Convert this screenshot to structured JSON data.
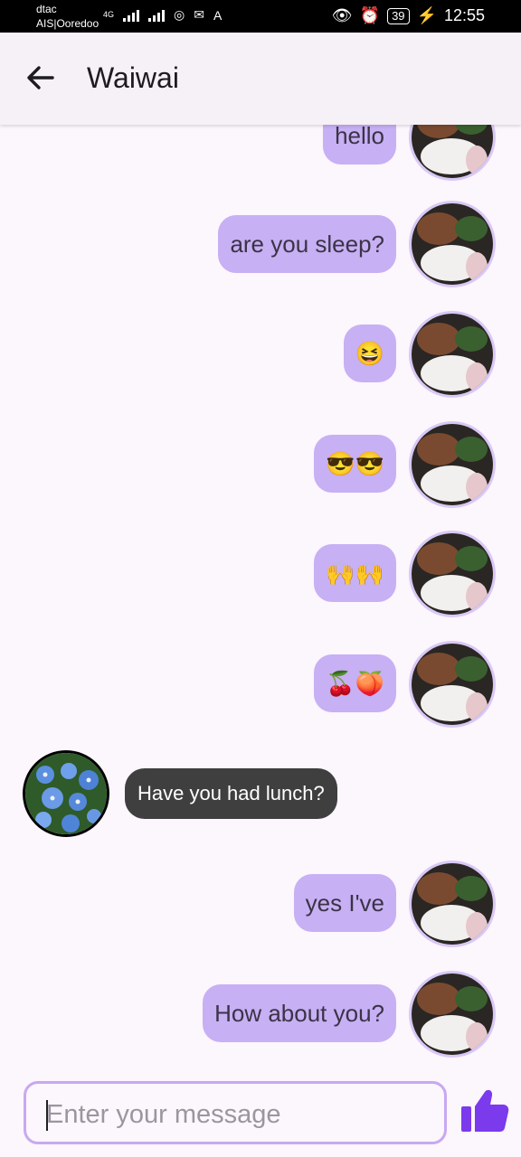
{
  "status_bar": {
    "carrier_1": "dtac",
    "carrier_2": "AIS|Ooredoo",
    "network": "4G",
    "battery": "39",
    "time": "12:55"
  },
  "header": {
    "title": "Waiwai"
  },
  "messages": [
    {
      "sender": "me",
      "text": "hello"
    },
    {
      "sender": "me",
      "text": "are you sleep?"
    },
    {
      "sender": "me",
      "text": "😆"
    },
    {
      "sender": "me",
      "text": "😎😎"
    },
    {
      "sender": "me",
      "text": "🙌🙌"
    },
    {
      "sender": "me",
      "text": "🍒🍑"
    },
    {
      "sender": "them",
      "text": "Have you had lunch?"
    },
    {
      "sender": "me",
      "text": "yes I've"
    },
    {
      "sender": "me",
      "text": "How about you?"
    }
  ],
  "composer": {
    "placeholder": "Enter your message"
  },
  "icons": {
    "back": "arrow-left-icon",
    "send": "thumbs-up-icon",
    "my_avatar": "food-photo-avatar",
    "their_avatar": "blue-flowers-avatar"
  },
  "colors": {
    "accent": "#7c3aed",
    "my_bubble": "#c7b0f4",
    "their_bubble": "#3f3f3f"
  }
}
